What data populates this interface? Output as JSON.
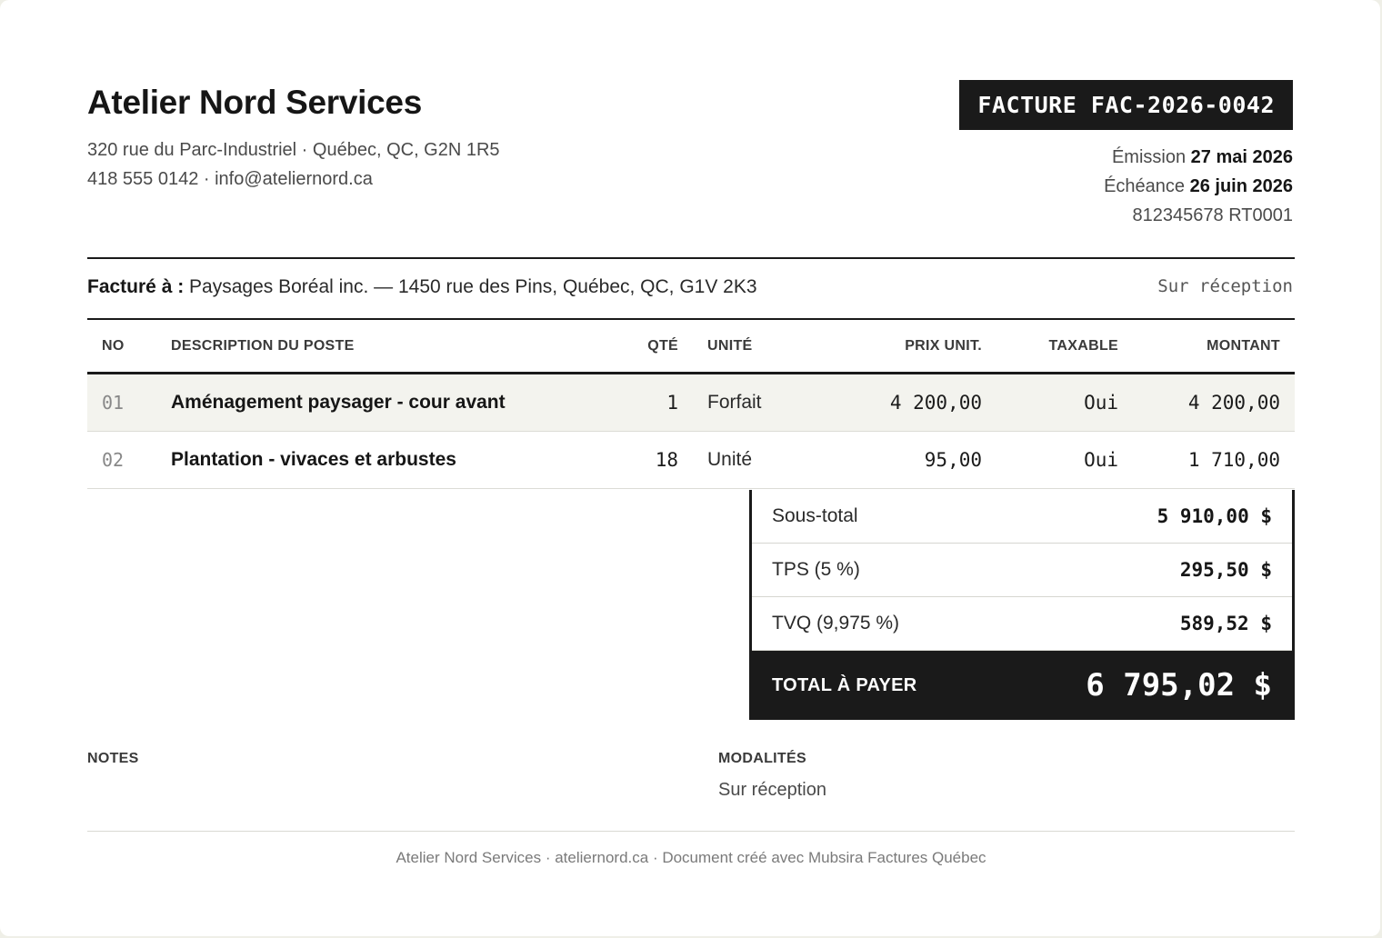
{
  "company": {
    "name": "Atelier Nord Services",
    "address_line": "320 rue du Parc-Industriel · Québec, QC, G2N 1R5",
    "contact_line": "418 555 0142 · info@ateliernord.ca"
  },
  "invoice": {
    "badge": "FACTURE FAC-2026-0042",
    "issue_label": "Émission",
    "issue_date": "27 mai 2026",
    "due_label": "Échéance",
    "due_date": "26 juin 2026",
    "tax_number": "812345678 RT0001"
  },
  "billing": {
    "label": "Facturé à :",
    "client": "Paysages Boréal inc. — 1450 rue des Pins, Québec, QC, G1V 2K3",
    "terms": "Sur réception"
  },
  "table": {
    "headers": {
      "no": "NO",
      "desc": "DESCRIPTION DU POSTE",
      "qty": "QTÉ",
      "unit": "UNITÉ",
      "price": "PRIX UNIT.",
      "taxable": "TAXABLE",
      "amount": "MONTANT"
    },
    "rows": [
      {
        "no": "01",
        "desc": "Aménagement paysager - cour avant",
        "qty": "1",
        "unit": "Forfait",
        "price": "4 200,00",
        "taxable": "Oui",
        "amount": "4 200,00"
      },
      {
        "no": "02",
        "desc": "Plantation - vivaces et arbustes",
        "qty": "18",
        "unit": "Unité",
        "price": "95,00",
        "taxable": "Oui",
        "amount": "1 710,00"
      }
    ]
  },
  "totals": {
    "subtotal_label": "Sous-total",
    "subtotal": "5 910,00 $",
    "tps_label": "TPS (5 %)",
    "tps": "295,50 $",
    "tvq_label": "TVQ (9,975 %)",
    "tvq": "589,52 $",
    "grand_label": "TOTAL À PAYER",
    "grand": "6 795,02 $"
  },
  "notes": {
    "notes_title": "NOTES",
    "modalites_title": "MODALITÉS",
    "modalites_text": "Sur réception"
  },
  "footer": {
    "text": "Atelier Nord Services · ateliernord.ca · Document créé avec Mubsira Factures Québec"
  },
  "colors": {
    "ink": "#1a1a1a",
    "page_bg": "#efefe7",
    "row_shade": "#f3f3ee"
  }
}
